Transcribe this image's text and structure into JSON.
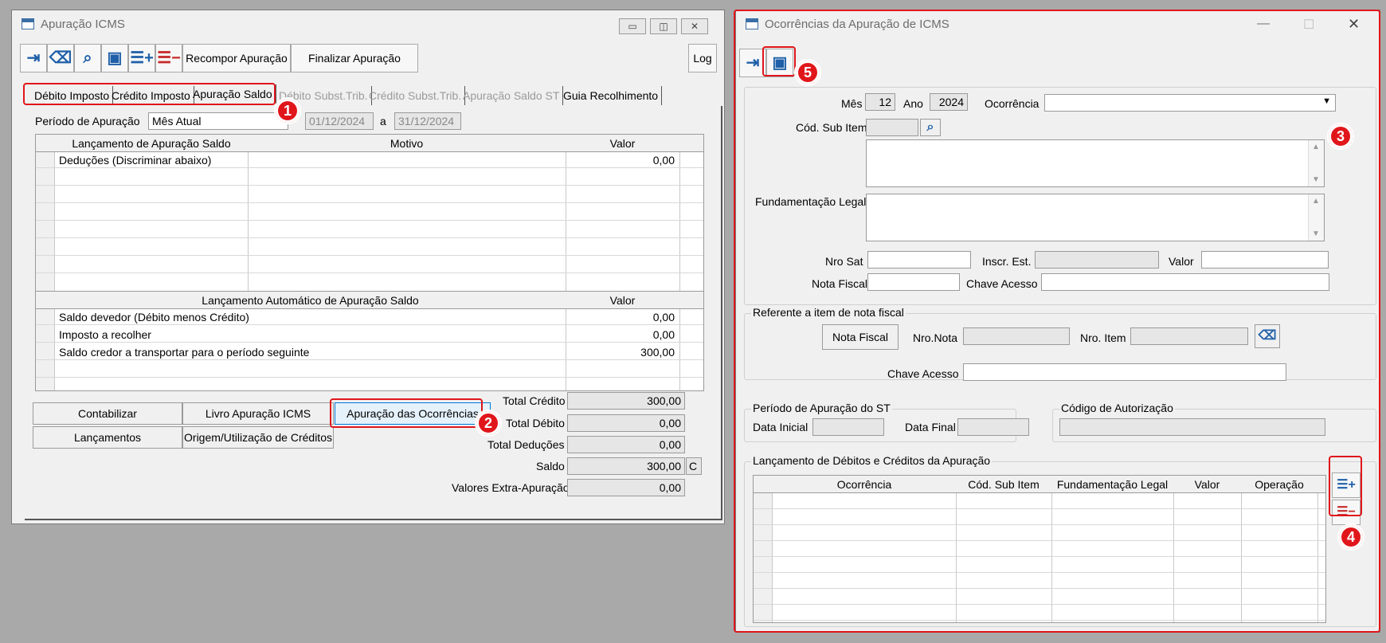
{
  "win1": {
    "title": "Apuração ICMS",
    "toolbar": {
      "recompor": "Recompor Apuração",
      "finalizar": "Finalizar Apuração",
      "log": "Log"
    },
    "tabs": [
      "Débito Imposto",
      "Crédito Imposto",
      "Apuração Saldo",
      "Débito Subst.Trib.",
      "Crédito Subst.Trib.",
      "Apuração Saldo ST",
      "Guia Recolhimento"
    ],
    "periodo_label": "Período de Apuração",
    "periodo_value": "Mês Atual",
    "date_from": "01/12/2024",
    "date_sep": "a",
    "date_to": "31/12/2024",
    "grid1": {
      "headers": [
        "Lançamento de Apuração Saldo",
        "Motivo",
        "Valor"
      ],
      "rows": [
        {
          "lanc": "Deduções (Discriminar abaixo)",
          "motivo": "",
          "valor": "0,00"
        }
      ]
    },
    "grid2": {
      "headers": [
        "Lançamento Automático de Apuração Saldo",
        "Valor"
      ],
      "rows": [
        {
          "lanc": "Saldo devedor (Débito menos Crédito)",
          "valor": "0,00"
        },
        {
          "lanc": "Imposto a recolher",
          "valor": "0,00"
        },
        {
          "lanc": "Saldo credor a transportar para o período seguinte",
          "valor": "300,00"
        }
      ]
    },
    "buttons": {
      "contabilizar": "Contabilizar",
      "livro": "Livro Apuração ICMS",
      "ocorrencias": "Apuração das Ocorrências",
      "lancamentos": "Lançamentos",
      "origem": "Origem/Utilização de Créditos"
    },
    "totals": {
      "credito_label": "Total Crédito",
      "credito": "300,00",
      "debito_label": "Total Débito",
      "debito": "0,00",
      "deducoes_label": "Total Deduções",
      "deducoes": "0,00",
      "saldo_label": "Saldo",
      "saldo": "300,00",
      "saldo_flag": "C",
      "extra_label": "Valores Extra-Apuração",
      "extra": "0,00"
    }
  },
  "win2": {
    "title": "Ocorrências da Apuração de ICMS",
    "mes_label": "Mês",
    "mes": "12",
    "ano_label": "Ano",
    "ano": "2024",
    "ocorrencia_label": "Ocorrência",
    "ocorrencia": "",
    "cod_sub_item_label": "Cód. Sub Item",
    "fundamentacao_label": "Fundamentação Legal",
    "nro_sat_label": "Nro Sat",
    "inscr_est_label": "Inscr. Est.",
    "valor_label": "Valor",
    "nota_fiscal_label": "Nota Fiscal",
    "chave_acesso_label": "Chave Acesso",
    "ref_group": "Referente a item de nota fiscal",
    "nota_fiscal_btn": "Nota Fiscal",
    "nro_nota_label": "Nro.Nota",
    "nro_item_label": "Nro. Item",
    "chave_acesso2_label": "Chave Acesso",
    "periodo_st_group": "Período de Apuração do ST",
    "data_inicial_label": "Data Inicial",
    "data_final_label": "Data Final",
    "cod_autorizacao_group": "Código de Autorização",
    "lanc_group": "Lançamento de Débitos e Créditos da Apuração",
    "grid_headers": [
      "Ocorrência",
      "Cód. Sub Item",
      "Fundamentação Legal",
      "Valor",
      "Operação"
    ]
  },
  "badges": [
    "1",
    "2",
    "3",
    "4",
    "5"
  ],
  "colors": {
    "annotation": "#e0161b",
    "icon_blue": "#1f5fa8",
    "icon_red": "#c62828"
  }
}
